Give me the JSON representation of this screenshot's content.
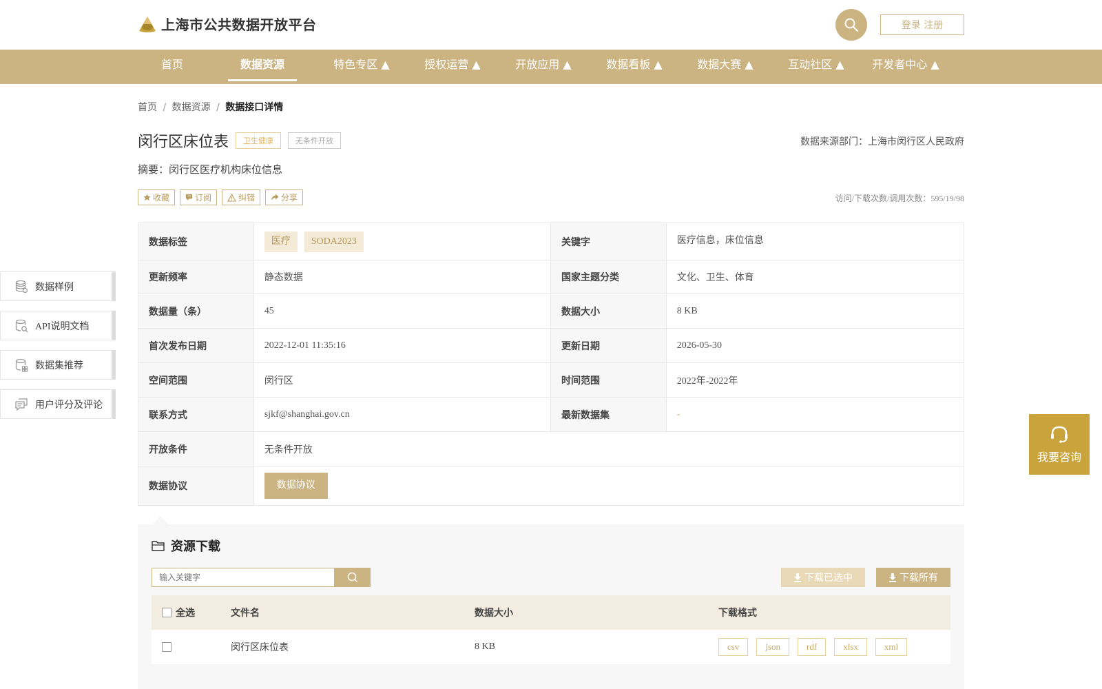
{
  "header": {
    "site_title": "上海市公共数据开放平台",
    "login_label": "登录 注册"
  },
  "nav": {
    "items": [
      {
        "label": "首页",
        "active": false
      },
      {
        "label": "数据资源",
        "active": true
      },
      {
        "label": "特色专区 ▲",
        "active": false
      },
      {
        "label": "授权运营 ▲",
        "active": false
      },
      {
        "label": "开放应用 ▲",
        "active": false
      },
      {
        "label": "数据看板 ▲",
        "active": false
      },
      {
        "label": "数据大赛 ▲",
        "active": false
      },
      {
        "label": "互动社区 ▲",
        "active": false
      },
      {
        "label": "开发者中心 ▲",
        "active": false
      }
    ]
  },
  "breadcrumb": {
    "home": "首页",
    "section": "数据资源",
    "separator": "/",
    "current": "数据接口详情"
  },
  "dataset": {
    "title": "闵行区床位表",
    "tag_category": "卫生健康",
    "tag_open": "无条件开放",
    "source_dept": "数据来源部门：上海市闵行区人民政府",
    "summary": "摘要：闵行区医疗机构床位信息",
    "stats": "访问/下载次数/调用次数：595/19/98"
  },
  "actions": {
    "favorite": "收藏",
    "subscribe": "订阅",
    "report": "纠错",
    "share": "分享"
  },
  "info": {
    "tags_label": "数据标签",
    "tags": [
      "医疗",
      "SODA2023"
    ],
    "keywords_label": "关键字",
    "keywords": "医疗信息，床位信息",
    "frequency_label": "更新频率",
    "frequency": "静态数据",
    "theme_label": "国家主题分类",
    "theme": "文化、卫生、体育",
    "count_label": "数据量（条）",
    "count": "45",
    "size_label": "数据大小",
    "size": "8 KB",
    "first_pub_label": "首次发布日期",
    "first_pub": "2022-12-01 11:35:16",
    "updated_label": "更新日期",
    "updated": "2026-05-30",
    "spatial_label": "空间范围",
    "spatial": "闵行区",
    "time_label": "时间范围",
    "time": "2022年-2022年",
    "contact_label": "联系方式",
    "contact": "sjkf@shanghai.gov.cn",
    "latest_label": "最新数据集",
    "latest": "-",
    "condition_label": "开放条件",
    "condition": "无条件开放",
    "protocol_label": "数据协议",
    "protocol_button": "数据协议"
  },
  "sidebar": {
    "items": [
      {
        "label": "数据样例",
        "icon": "database-icon"
      },
      {
        "label": "API说明文档",
        "icon": "api-doc-icon"
      },
      {
        "label": "数据集推荐",
        "icon": "dataset-recommend-icon"
      },
      {
        "label": "用户评分及评论",
        "icon": "comment-icon"
      }
    ]
  },
  "consult": {
    "label": "我要咨询"
  },
  "downloads": {
    "title": "资源下载",
    "search_placeholder": "输入关键字",
    "download_selected": "下载已选中",
    "download_all": "下载所有",
    "columns": {
      "select_all": "全选",
      "filename": "文件名",
      "size": "数据大小",
      "format": "下载格式"
    },
    "rows": [
      {
        "filename": "闵行区床位表",
        "size": "8 KB",
        "formats": [
          "csv",
          "json",
          "rdf",
          "xlsx",
          "xml"
        ]
      }
    ]
  },
  "colors": {
    "accent": "#cbb482",
    "consult_bg": "#c9a43c",
    "tag_gold": "#e0b660"
  }
}
